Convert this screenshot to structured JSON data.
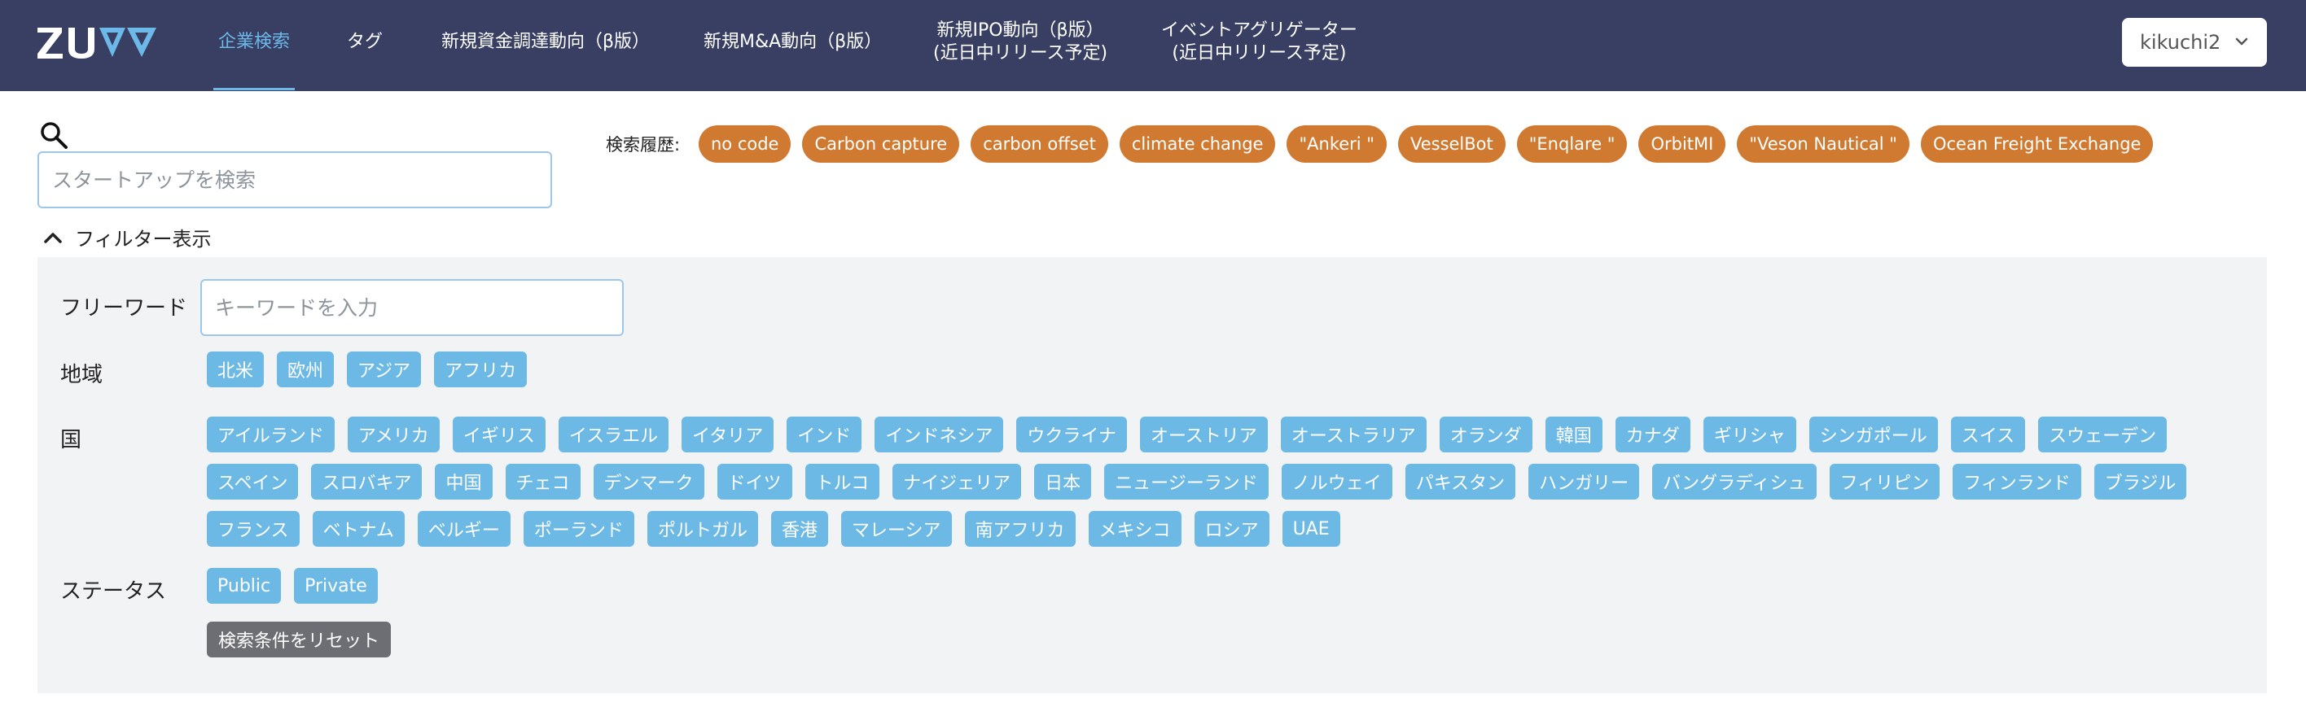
{
  "brand": {
    "logo_text": "ZUVA",
    "accent": "#6cb8e8",
    "navbar_bg": "#383f63"
  },
  "nav": {
    "items": [
      {
        "label": "企業検索",
        "active": true
      },
      {
        "label": "タグ"
      },
      {
        "label": "新規資金調達動向（β版）"
      },
      {
        "label": "新規M&A動向（β版）"
      },
      {
        "line1": "新規IPO動向（β版）",
        "line2": "(近日中リリース予定)"
      },
      {
        "line1": "イベントアグリゲーター",
        "line2": "(近日中リリース予定)"
      }
    ],
    "user": {
      "name": "kikuchi2"
    }
  },
  "search": {
    "placeholder": "スタートアップを検索",
    "value": "",
    "icon": "search-icon"
  },
  "history": {
    "label": "検索履歴:",
    "items": [
      "no code",
      "Carbon capture",
      "carbon offset",
      "climate change",
      "\"Ankeri \"",
      "VesselBot",
      "\"Enqlare \"",
      "OrbitMI",
      "\"Veson Nautical \"",
      "Ocean Freight Exchange"
    ],
    "tag_color": "#d07a31"
  },
  "filter": {
    "toggle_label": "フィルター表示",
    "freeword": {
      "label": "フリーワード",
      "placeholder": "キーワードを入力"
    },
    "region": {
      "label": "地域",
      "options": [
        "北米",
        "欧州",
        "アジア",
        "アフリカ"
      ]
    },
    "country": {
      "label": "国",
      "options": [
        "アイルランド",
        "アメリカ",
        "イギリス",
        "イスラエル",
        "イタリア",
        "インド",
        "インドネシア",
        "ウクライナ",
        "オーストリア",
        "オーストラリア",
        "オランダ",
        "韓国",
        "カナダ",
        "ギリシャ",
        "シンガポール",
        "スイス",
        "スウェーデン",
        "スペイン",
        "スロバキア",
        "中国",
        "チェコ",
        "デンマーク",
        "ドイツ",
        "トルコ",
        "ナイジェリア",
        "日本",
        "ニュージーランド",
        "ノルウェイ",
        "パキスタン",
        "ハンガリー",
        "バングラディシュ",
        "フィリピン",
        "フィンランド",
        "ブラジル",
        "フランス",
        "ベトナム",
        "ベルギー",
        "ポーランド",
        "ポルトガル",
        "香港",
        "マレーシア",
        "南アフリカ",
        "メキシコ",
        "ロシア",
        "UAE"
      ]
    },
    "status": {
      "label": "ステータス",
      "options": [
        "Public",
        "Private"
      ]
    },
    "reset_label": "検索条件をリセット",
    "chip_color": "#6cb9e6"
  }
}
